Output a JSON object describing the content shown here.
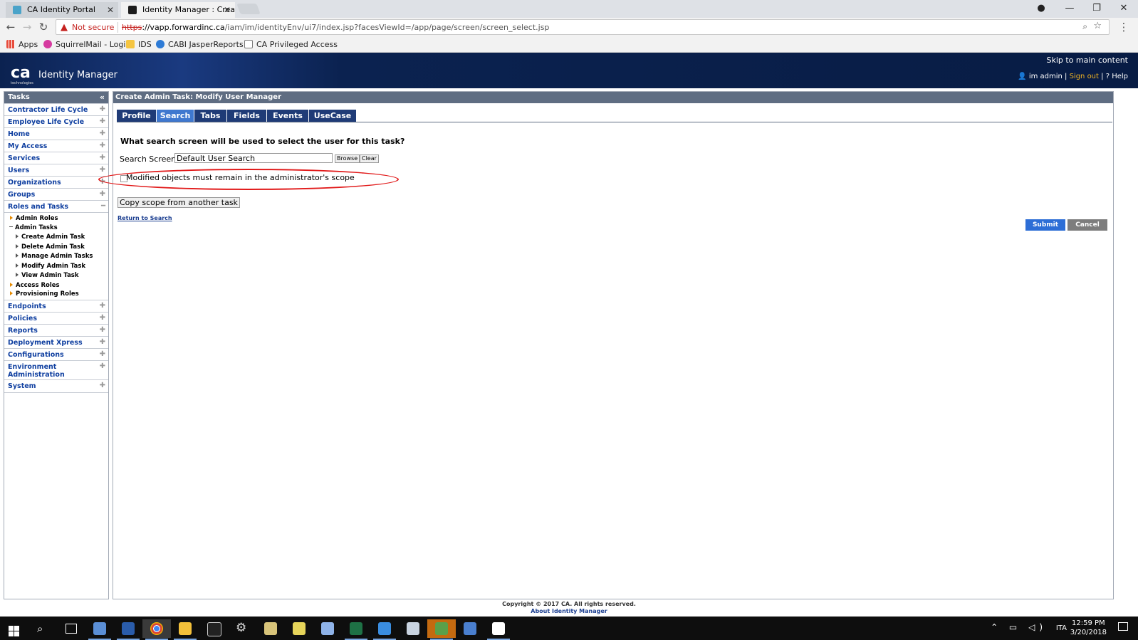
{
  "browser": {
    "tabs": [
      {
        "title": "CA Identity Portal"
      },
      {
        "title": "Identity Manager : Create"
      }
    ],
    "address": {
      "security_label": "Not secure",
      "url_scheme": "https",
      "url_host": "://vapp.forwardinc.ca",
      "url_path": "/iam/im/identityEnv/ui7/index.jsp?facesViewId=/app/page/screen/screen_select.jsp"
    },
    "bookmarks": [
      {
        "label": "Apps"
      },
      {
        "label": "SquirrelMail - Login"
      },
      {
        "label": "IDS"
      },
      {
        "label": "CABI JasperReports S"
      },
      {
        "label": "CA Privileged Access"
      }
    ]
  },
  "header": {
    "logo_text": "ca",
    "logo_subtext": "technologies",
    "app_title": "Identity Manager",
    "skip_link": "Skip to main content",
    "user": "im admin",
    "signout": "Sign out",
    "help": "Help"
  },
  "sidebar": {
    "title": "Tasks",
    "categories_top": [
      {
        "label": "Contractor Life Cycle"
      },
      {
        "label": "Employee Life Cycle"
      },
      {
        "label": "Home"
      },
      {
        "label": "My Access"
      },
      {
        "label": "Services"
      },
      {
        "label": "Users"
      },
      {
        "label": "Organizations"
      },
      {
        "label": "Groups"
      },
      {
        "label": "Roles and Tasks"
      }
    ],
    "roles_subitems": [
      {
        "label": "Admin Roles"
      },
      {
        "label": "Admin Tasks"
      },
      {
        "label": "Create Admin Task"
      },
      {
        "label": "Delete Admin Task"
      },
      {
        "label": "Manage Admin Tasks"
      },
      {
        "label": "Modify Admin Task"
      },
      {
        "label": "View Admin Task"
      },
      {
        "label": "Access Roles"
      },
      {
        "label": "Provisioning Roles"
      }
    ],
    "categories_bottom": [
      {
        "label": "Endpoints"
      },
      {
        "label": "Policies"
      },
      {
        "label": "Reports"
      },
      {
        "label": "Deployment Xpress"
      },
      {
        "label": "Configurations"
      },
      {
        "label": "Environment Administration"
      },
      {
        "label": "System"
      }
    ]
  },
  "main": {
    "panel_title": "Create Admin Task: Modify User Manager",
    "tabs": [
      {
        "label": "Profile"
      },
      {
        "label": "Search"
      },
      {
        "label": "Tabs"
      },
      {
        "label": "Fields"
      },
      {
        "label": "Events"
      },
      {
        "label": "UseCase"
      }
    ],
    "selected_tab": "Search",
    "question": "What search screen will be used to select the user for this task?",
    "search_screen_label": "Search Screen",
    "search_screen_value": "Default User Search",
    "browse_label": "Browse",
    "clear_label": "Clear",
    "scope_checkbox_label": "Modified objects must remain in the administrator's scope",
    "scope_checkbox_checked": false,
    "copy_scope_label": "Copy scope from another task",
    "return_link": "Return to Search",
    "submit_label": "Submit",
    "cancel_label": "Cancel",
    "highlight_color": "#e11a1a"
  },
  "footer": {
    "copyright": "Copyright © 2017 CA. All rights reserved.",
    "about": "About Identity Manager"
  },
  "taskbar": {
    "language": "ITA",
    "time": "12:59 PM",
    "date": "3/20/2018"
  },
  "colors": {
    "header_bg": "#0b2250",
    "panel_header": "#5f6d82",
    "tab_bg": "#1f3b77",
    "tab_selected": "#3f78cf",
    "link": "#0f3fa0",
    "submit": "#2d6ed6",
    "cancel": "#7d7d7d"
  }
}
